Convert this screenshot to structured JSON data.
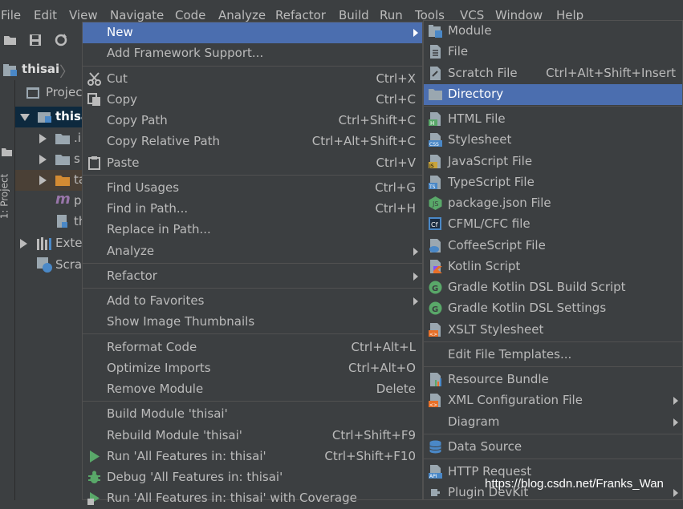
{
  "menubar": [
    "File",
    "Edit",
    "View",
    "Navigate",
    "Code",
    "Analyze",
    "Refactor",
    "Build",
    "Run",
    "Tools",
    "VCS",
    "Window",
    "Help"
  ],
  "navbar": {
    "project": "thisai"
  },
  "side_tab": "1: Project",
  "project_panel": {
    "header": "Projec",
    "rows": [
      "thisa",
      ".i",
      "s",
      "ta",
      "p",
      "th",
      "Exter",
      "Scrat"
    ]
  },
  "context_menu": {
    "items": [
      {
        "label": "New",
        "shortcut": "",
        "submenu": true,
        "selected": true
      },
      {
        "label": "Add Framework Support...",
        "shortcut": ""
      },
      {
        "label": "Cut",
        "shortcut": "Ctrl+X",
        "icon": "scissors-icon"
      },
      {
        "label": "Copy",
        "shortcut": "Ctrl+C",
        "icon": "copy-icon"
      },
      {
        "label": "Copy Path",
        "shortcut": "Ctrl+Shift+C"
      },
      {
        "label": "Copy Relative Path",
        "shortcut": "Ctrl+Alt+Shift+C"
      },
      {
        "label": "Paste",
        "shortcut": "Ctrl+V",
        "icon": "clipboard-icon"
      },
      {
        "label": "Find Usages",
        "shortcut": "Ctrl+G"
      },
      {
        "label": "Find in Path...",
        "shortcut": "Ctrl+H"
      },
      {
        "label": "Replace in Path...",
        "shortcut": ""
      },
      {
        "label": "Analyze",
        "shortcut": "",
        "submenu": true
      },
      {
        "label": "Refactor",
        "shortcut": "",
        "submenu": true
      },
      {
        "label": "Add to Favorites",
        "shortcut": "",
        "submenu": true
      },
      {
        "label": "Show Image Thumbnails",
        "shortcut": ""
      },
      {
        "label": "Reformat Code",
        "shortcut": "Ctrl+Alt+L"
      },
      {
        "label": "Optimize Imports",
        "shortcut": "Ctrl+Alt+O"
      },
      {
        "label": "Remove Module",
        "shortcut": "Delete"
      },
      {
        "label": "Build Module 'thisai'",
        "shortcut": ""
      },
      {
        "label": "Rebuild Module 'thisai'",
        "shortcut": "Ctrl+Shift+F9"
      },
      {
        "label": "Run 'All Features in: thisai'",
        "shortcut": "Ctrl+Shift+F10",
        "icon": "run-icon"
      },
      {
        "label": "Debug 'All Features in: thisai'",
        "shortcut": "",
        "icon": "debug-icon"
      },
      {
        "label": "Run 'All Features in: thisai' with Coverage",
        "shortcut": "",
        "icon": "coverage-icon"
      }
    ]
  },
  "submenu_new": {
    "items": [
      {
        "label": "Module",
        "shortcut": "",
        "icon": "module-icon"
      },
      {
        "label": "File",
        "shortcut": "",
        "icon": "file-icon"
      },
      {
        "label": "Scratch File",
        "shortcut": "Ctrl+Alt+Shift+Insert",
        "icon": "scratch-file-icon"
      },
      {
        "label": "Directory",
        "shortcut": "",
        "icon": "folder-icon",
        "selected": true
      },
      {
        "label": "HTML File",
        "icon": "html-file-icon"
      },
      {
        "label": "Stylesheet",
        "icon": "css-file-icon"
      },
      {
        "label": "JavaScript File",
        "icon": "js-file-icon"
      },
      {
        "label": "TypeScript File",
        "icon": "ts-file-icon"
      },
      {
        "label": "package.json File",
        "icon": "nodejs-icon"
      },
      {
        "label": "CFML/CFC file",
        "icon": "cfml-icon"
      },
      {
        "label": "CoffeeScript File",
        "icon": "coffeescript-icon"
      },
      {
        "label": "Kotlin Script",
        "icon": "kotlin-icon"
      },
      {
        "label": "Gradle Kotlin DSL Build Script",
        "icon": "gradle-icon"
      },
      {
        "label": "Gradle Kotlin DSL Settings",
        "icon": "gradle-icon"
      },
      {
        "label": "XSLT Stylesheet",
        "icon": "xslt-icon"
      },
      {
        "label": "Edit File Templates..."
      },
      {
        "label": "Resource Bundle",
        "icon": "resource-bundle-icon"
      },
      {
        "label": "XML Configuration File",
        "submenu": true,
        "icon": "xml-config-icon"
      },
      {
        "label": "Diagram",
        "submenu": true
      },
      {
        "label": "Data Source",
        "icon": "database-icon"
      },
      {
        "label": "HTTP Request",
        "icon": "api-icon"
      },
      {
        "label": "Plugin DevKit",
        "submenu": true,
        "icon": "plugin-icon"
      }
    ]
  },
  "watermark": "https://blog.csdn.net/Franks_Wan",
  "colors": {
    "bg": "#3c3f41",
    "selection": "#4b6eaf",
    "text": "#bbbbbb",
    "separator": "#515151"
  }
}
